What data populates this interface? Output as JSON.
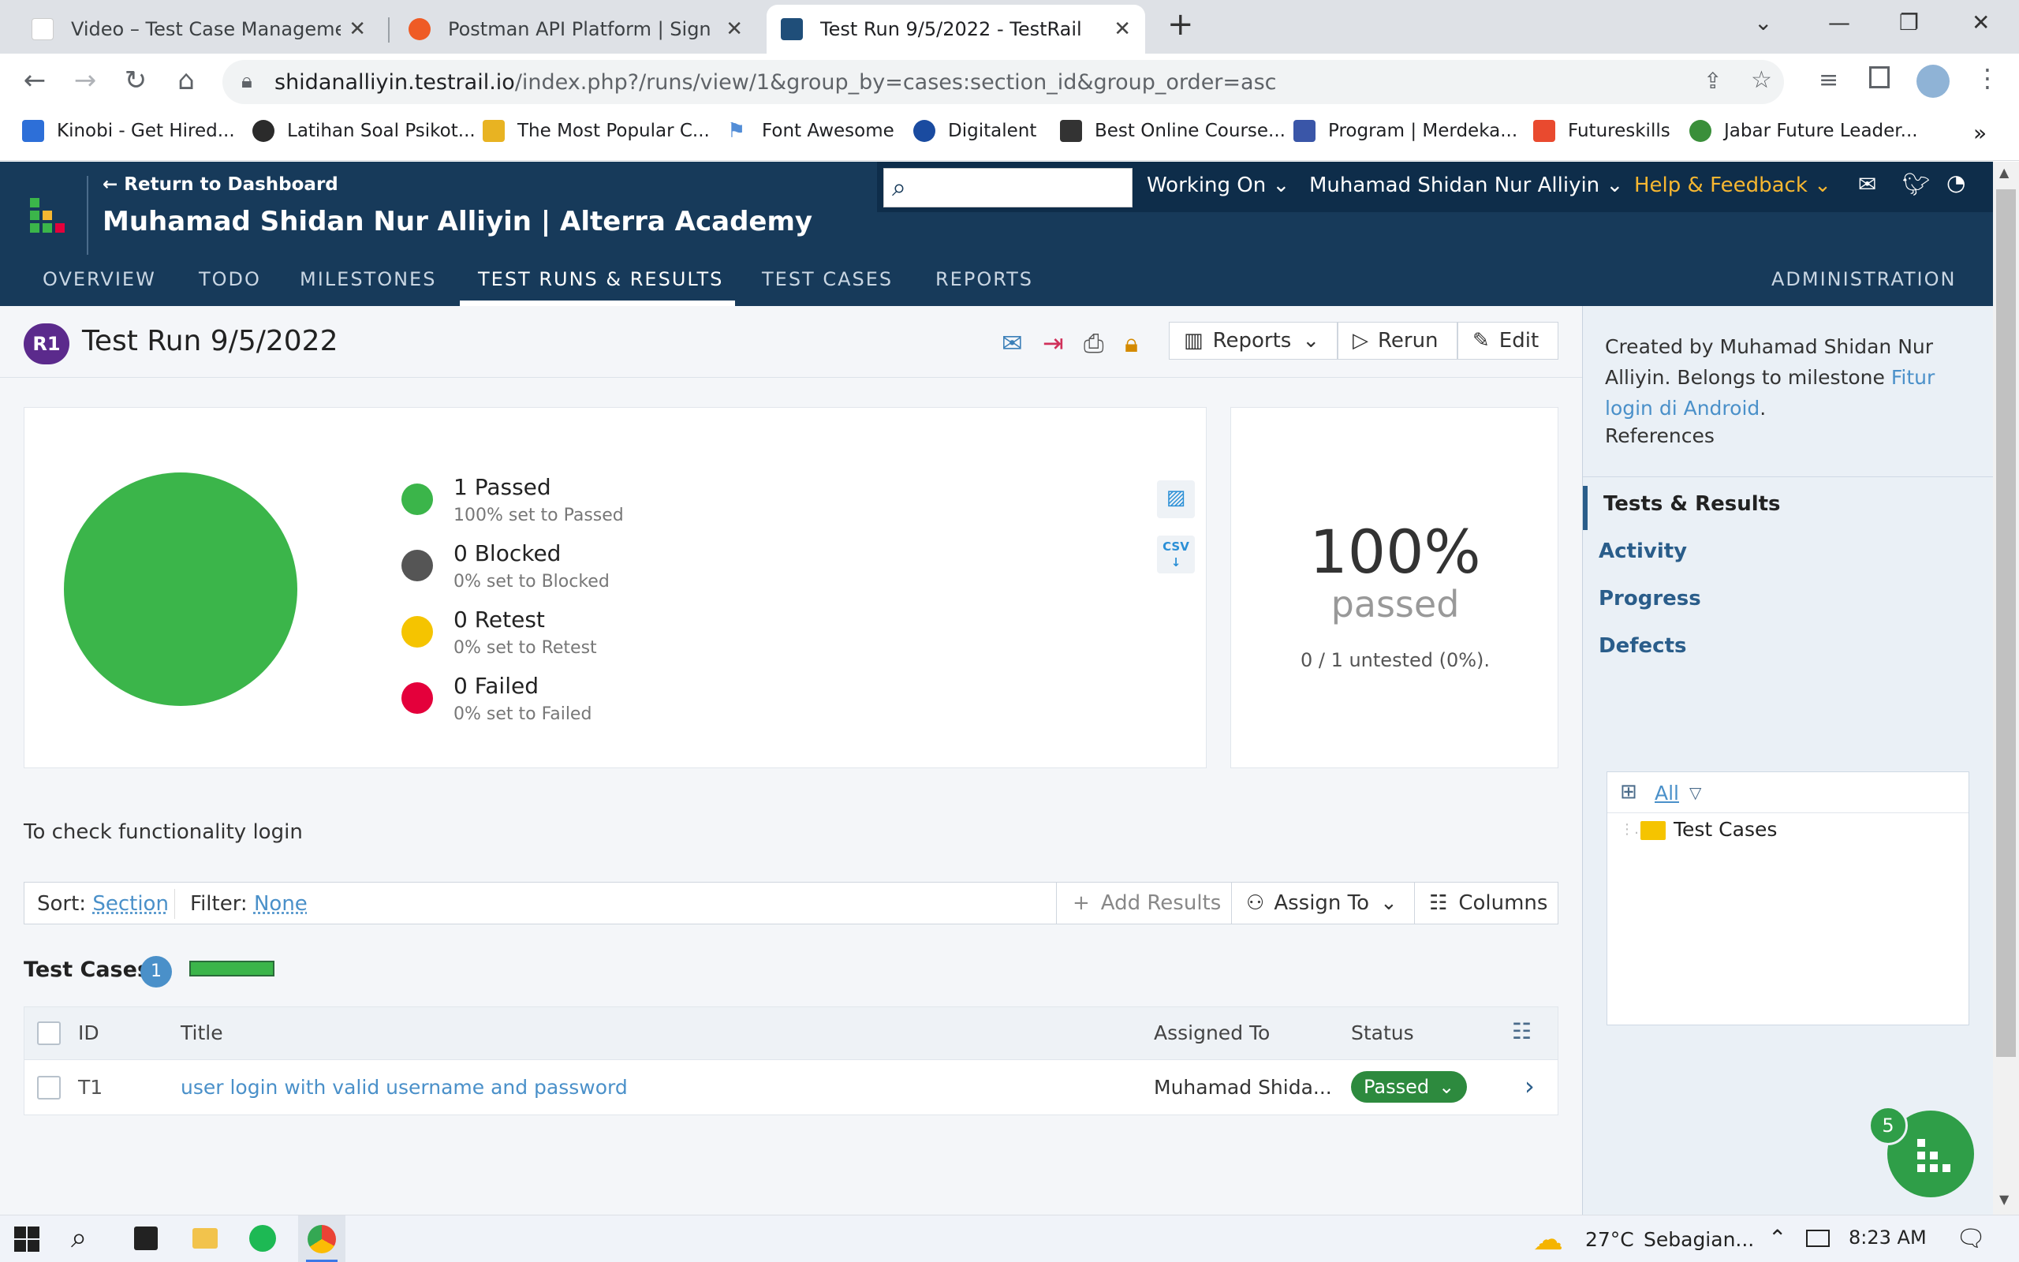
{
  "browser": {
    "tabs": [
      {
        "title": "Video – Test Case Management T",
        "active": false
      },
      {
        "title": "Postman API Platform | Sign Up f",
        "active": false
      },
      {
        "title": "Test Run 9/5/2022 - TestRail",
        "active": true
      }
    ],
    "url_domain": "shidanalliyin.testrail.io",
    "url_path": "/index.php?/runs/view/1&group_by=cases:section_id&group_order=asc",
    "bookmarks": [
      "Kinobi - Get Hired...",
      "Latihan Soal Psikot...",
      "The Most Popular C...",
      "Font Awesome",
      "Digitalent",
      "Best Online Course...",
      "Program | Merdeka...",
      "Futureskills",
      "Jabar Future Leader..."
    ]
  },
  "header": {
    "return_link": "← Return to Dashboard",
    "project_title": "Muhamad Shidan Nur Alliyin | Alterra Academy",
    "working_on": "Working On",
    "user_name": "Muhamad Shidan Nur Alliyin",
    "help": "Help & Feedback",
    "nav": [
      "OVERVIEW",
      "TODO",
      "MILESTONES",
      "TEST RUNS & RESULTS",
      "TEST CASES",
      "REPORTS"
    ],
    "active_nav": "TEST RUNS & RESULTS",
    "admin": "ADMINISTRATION"
  },
  "run": {
    "badge": "R1",
    "title": "Test Run 9/5/2022",
    "buttons": {
      "reports": "Reports",
      "rerun": "Rerun",
      "edit": "Edit"
    },
    "description": "To check functionality login"
  },
  "stats": {
    "legend": [
      {
        "title": "1 Passed",
        "sub": "100% set to Passed",
        "color": "#3bb54a"
      },
      {
        "title": "0 Blocked",
        "sub": "0% set to Blocked",
        "color": "#555555"
      },
      {
        "title": "0 Retest",
        "sub": "0% set to Retest",
        "color": "#f5c400"
      },
      {
        "title": "0 Failed",
        "sub": "0% set to Failed",
        "color": "#e4003b"
      }
    ],
    "csv_label": "CSV",
    "percent": "100%",
    "percent_label": "passed",
    "untested": "0 / 1 untested (0%)."
  },
  "toolbar": {
    "sort_label": "Sort:",
    "sort_value": "Section",
    "filter_label": "Filter:",
    "filter_value": "None",
    "add_results": "Add Results",
    "assign_to": "Assign To",
    "columns": "Columns"
  },
  "section": {
    "title": "Test Cases",
    "count": "1",
    "progress_passed": 1.0
  },
  "table": {
    "headers": {
      "id": "ID",
      "title": "Title",
      "assigned": "Assigned To",
      "status": "Status"
    },
    "rows": [
      {
        "id": "T1",
        "title": "user login with valid username and password",
        "assigned": "Muhamad Shida...",
        "status": "Passed"
      }
    ]
  },
  "sidebar": {
    "created_text": "Created by Muhamad Shidan Nur Alliyin. Belongs to milestone ",
    "milestone_link": "Fitur login di Android",
    "period": ".",
    "references": "References",
    "menu": [
      "Tests & Results",
      "Activity",
      "Progress",
      "Defects"
    ],
    "tree_filter": "All",
    "tree_item": "Test Cases"
  },
  "fab": {
    "badge": "5"
  },
  "taskbar": {
    "weather_temp": "27°C",
    "weather_text": "Sebagian...",
    "time": "8:23 AM"
  },
  "colors": {
    "header_bg": "#173a5a",
    "passed_green": "#3bb54a",
    "link_blue": "#4a90c9",
    "help_orange": "#f7b731"
  }
}
